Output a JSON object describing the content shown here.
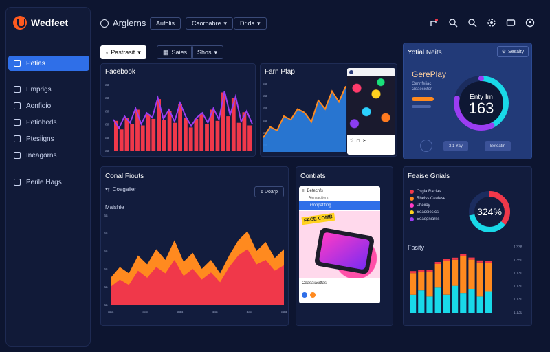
{
  "brand": {
    "name": "Wedfeet"
  },
  "sidebar": {
    "items": [
      {
        "label": "Petias",
        "active": true
      },
      {
        "label": "Emprigs",
        "active": false
      },
      {
        "label": "Aonfioio",
        "active": false
      },
      {
        "label": "Petioheds",
        "active": false
      },
      {
        "label": "Ptesiigns",
        "active": false
      },
      {
        "label": "Ineagorns",
        "active": false
      },
      {
        "label": "Perile Hags",
        "active": false
      }
    ]
  },
  "header": {
    "title": "Arglerns",
    "buttons": [
      "Aufolis",
      "Caorpabre",
      "Drids"
    ]
  },
  "toolbar": {
    "primary": "Pastrasit",
    "secondary": [
      "Saies",
      "Shos"
    ]
  },
  "panels": {
    "facebook": {
      "title": "Facebook",
      "ticks": [
        "aa",
        "aa",
        "aa",
        "aa",
        "aa",
        "aa"
      ]
    },
    "farm": {
      "title": "Farn Pfap"
    },
    "totals": {
      "title": "Yotial Neits",
      "button": "Sesaity",
      "subtitle": "GerePlay",
      "sub_lines": [
        "Cennfeiiac",
        "Geaecicton"
      ],
      "ring_text_top": "Enty Im",
      "ring_value": "163",
      "ring_fraction": 0.78,
      "buttons": [
        "3.1 Yay",
        "Beteatin"
      ]
    },
    "conel": {
      "title": "Conal Fiouts",
      "filter": "Coagaiier",
      "right_btn": "6 Doarp",
      "sub": "Maishie",
      "ticks_left": [
        "aa",
        "aa",
        "aa",
        "aa",
        "aa",
        "aa"
      ],
      "ticks_bottom": [
        "aaa",
        "aaa",
        "aaa",
        "aaa",
        "aaa",
        "aaa"
      ]
    },
    "contents": {
      "title": "Contiats",
      "card_title": "Betecnfs",
      "card_sub": "Aiensacitiers",
      "card_bar": "Gonpatifiog",
      "sticker": "FACE COMB",
      "caption": "Ceasaiacittas"
    },
    "feature": {
      "title": "Feaise Gnials",
      "legend": [
        "Csgia Raclas",
        "Rheiss Ceaiese",
        "Pbeiiay",
        "Seaosiesics",
        "Eoaegniarss"
      ],
      "ring_value": "324%",
      "ring_fraction": 0.72,
      "sub": "Fasity",
      "right_ticks": [
        "1,338",
        "1,350",
        "1,130",
        "1,130",
        "1,130",
        "1,130"
      ]
    }
  },
  "chart_data": [
    {
      "type": "area",
      "title": "Facebook",
      "values": [
        0.45,
        0.32,
        0.5,
        0.4,
        0.62,
        0.38,
        0.55,
        0.48,
        0.78,
        0.46,
        0.6,
        0.42,
        0.7,
        0.5,
        0.35,
        0.48,
        0.55,
        0.4,
        0.62,
        0.45,
        0.88,
        0.52,
        0.8,
        0.42,
        0.58,
        0.38
      ]
    },
    {
      "type": "area",
      "title": "Farn Pfap",
      "values": [
        0.2,
        0.35,
        0.3,
        0.5,
        0.45,
        0.6,
        0.55,
        0.42,
        0.72,
        0.6,
        0.85,
        0.7,
        0.92
      ]
    },
    {
      "type": "area",
      "title": "Conal Fiouts",
      "series": [
        {
          "values": [
            0.3,
            0.42,
            0.35,
            0.55,
            0.45,
            0.62,
            0.5,
            0.72,
            0.48,
            0.58,
            0.4,
            0.5,
            0.35,
            0.55,
            0.72,
            0.82,
            0.6,
            0.7,
            0.52,
            0.62
          ]
        },
        {
          "values": [
            0.2,
            0.28,
            0.22,
            0.38,
            0.3,
            0.42,
            0.35,
            0.5,
            0.32,
            0.4,
            0.28,
            0.36,
            0.25,
            0.42,
            0.55,
            0.62,
            0.45,
            0.5,
            0.38,
            0.44
          ]
        }
      ]
    },
    {
      "type": "bar",
      "title": "Fasity",
      "series": [
        {
          "values": [
            0.2,
            0.25,
            0.18,
            0.28,
            0.2,
            0.3,
            0.22,
            0.26,
            0.18,
            0.24
          ]
        },
        {
          "values": [
            0.35,
            0.3,
            0.4,
            0.38,
            0.55,
            0.42,
            0.6,
            0.48,
            0.55,
            0.45
          ]
        }
      ]
    }
  ],
  "colors": {
    "accent": "#2f6fe8",
    "red": "#f0384a",
    "orange": "#ff8a1f",
    "blue": "#2b7fe0",
    "cyan": "#19d8e8",
    "purple": "#9b3df2"
  }
}
